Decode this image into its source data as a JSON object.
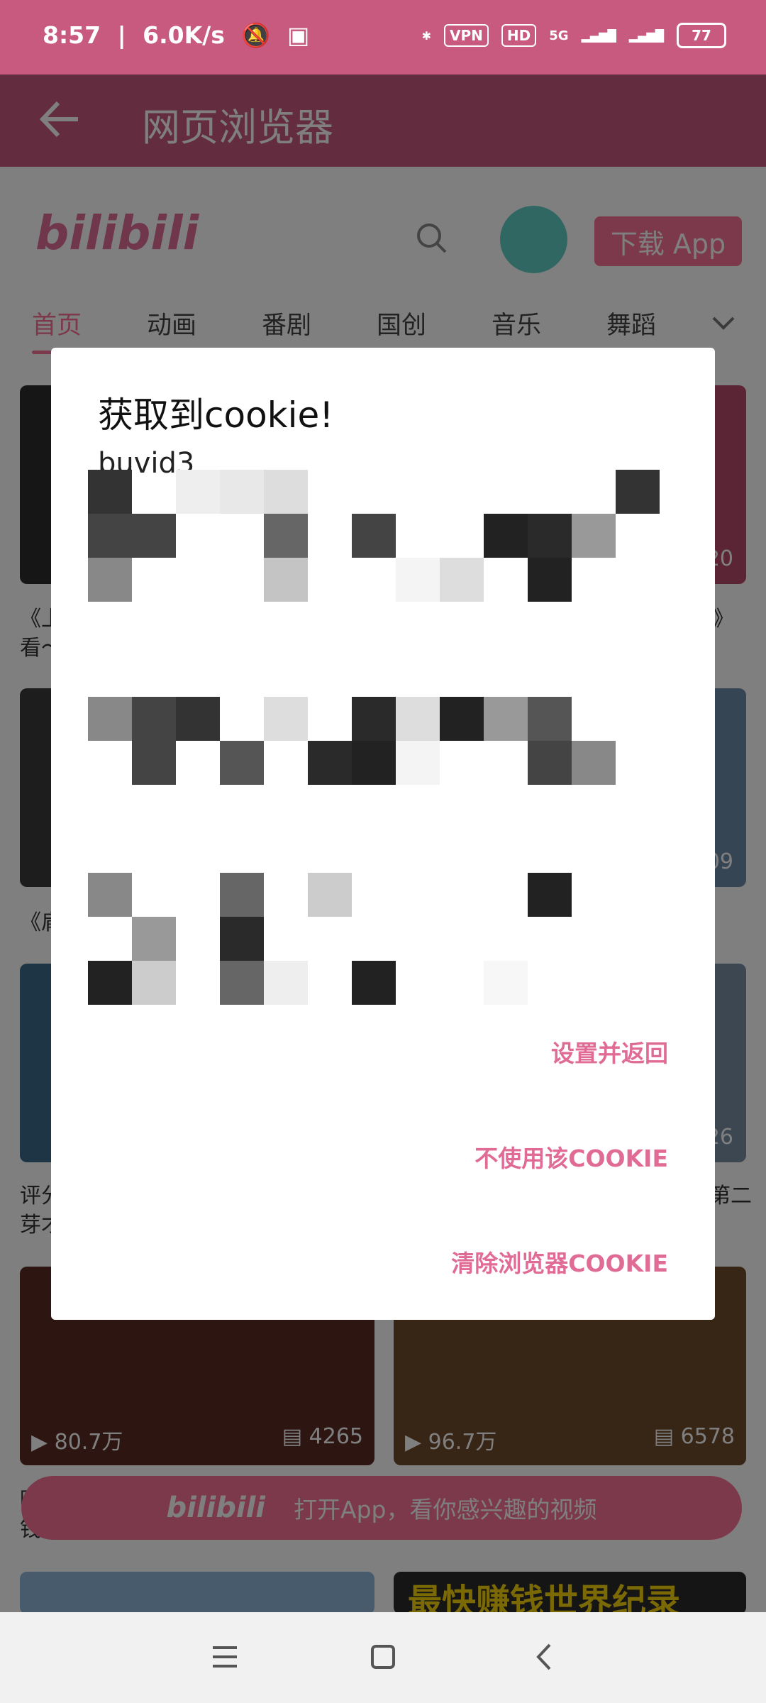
{
  "status_bar": {
    "time": "8:57",
    "speed": "6.0K/s",
    "vpn": "VPN",
    "hd": "HD",
    "network": "5G",
    "battery": "77"
  },
  "app_bar": {
    "title": "网页浏览器"
  },
  "site": {
    "logo": "bilibili",
    "download_label": "下载 App",
    "tabs": [
      "首页",
      "动画",
      "番剧",
      "国创",
      "音乐",
      "舞蹈"
    ]
  },
  "cards": [
    {
      "views": "80.7万",
      "comments": "4265"
    },
    {
      "views": "96.7万",
      "comments": "6578"
    }
  ],
  "partial_texts": {
    "row1_left": "《上",
    "row1_left_2": "看～",
    "row1_right_num": "20",
    "row1_right_char": "》",
    "row2_left": "《肩",
    "row2_right_num": "09",
    "row3_left": "评分",
    "row3_left_2": "芽才",
    "row3_right_num": "26",
    "row3_right_text": "第二",
    "row4_left": "吵",
    "row4_left_2": "钱"
  },
  "banner_bottom": "最快赚钱世界纪录",
  "open_app": {
    "logo": "bilibili",
    "text": "打开App，看你感兴趣的视频"
  },
  "dialog": {
    "title": "获取到cookie!",
    "body": "buvid3",
    "buttons": {
      "set_return": "设置并返回",
      "dont_use": "不使用该COOKIE",
      "clear": "清除浏览器COOKIE"
    }
  }
}
